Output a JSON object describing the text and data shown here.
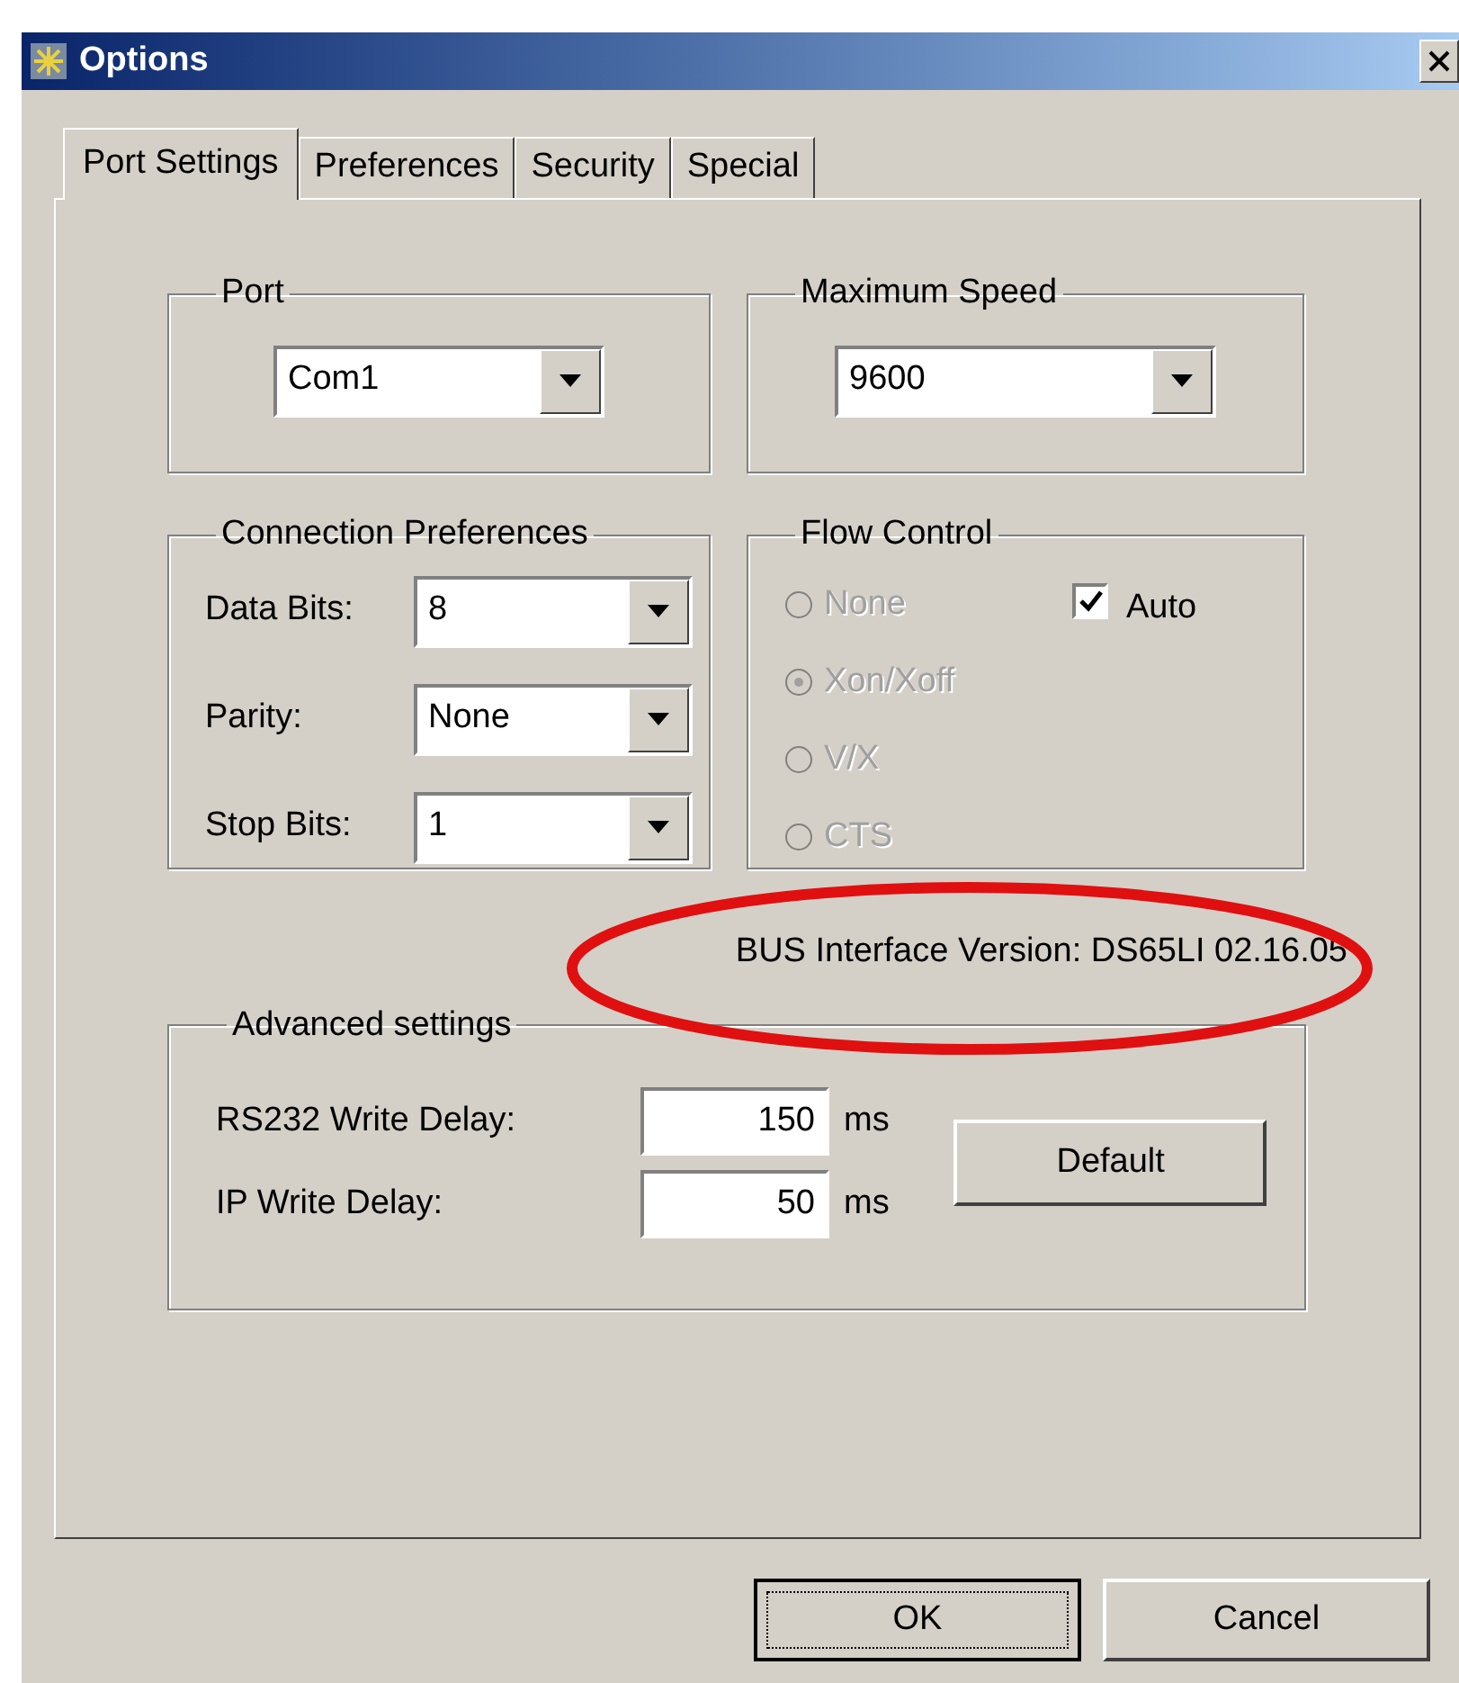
{
  "window": {
    "title": "Options"
  },
  "tabs": [
    {
      "label": "Port Settings",
      "selected": true
    },
    {
      "label": "Preferences",
      "selected": false
    },
    {
      "label": "Security",
      "selected": false
    },
    {
      "label": "Special",
      "selected": false
    }
  ],
  "port": {
    "title": "Port",
    "value": "Com1"
  },
  "max_speed": {
    "title": "Maximum Speed",
    "value": "9600"
  },
  "connection_preferences": {
    "title": "Connection Preferences",
    "fields": [
      {
        "label": "Data Bits:",
        "value": "8"
      },
      {
        "label": "Parity:",
        "value": "None"
      },
      {
        "label": "Stop Bits:",
        "value": "1"
      }
    ]
  },
  "flow_control": {
    "title": "Flow Control",
    "options": [
      {
        "label": "None",
        "selected": false,
        "disabled": true
      },
      {
        "label": "Xon/Xoff",
        "selected": true,
        "disabled": true
      },
      {
        "label": "V/X",
        "selected": false,
        "disabled": true
      },
      {
        "label": "CTS",
        "selected": false,
        "disabled": true
      }
    ],
    "auto": {
      "label": "Auto",
      "checked": true
    }
  },
  "version": "BUS Interface Version: DS65LI 02.16.05",
  "advanced": {
    "title": "Advanced settings",
    "fields": [
      {
        "label": "RS232 Write Delay:",
        "value": "150",
        "unit": "ms"
      },
      {
        "label": "IP Write Delay:",
        "value": "50",
        "unit": "ms"
      }
    ],
    "default_button": "Default"
  },
  "buttons": [
    {
      "label": "OK",
      "default": true
    },
    {
      "label": "Cancel",
      "default": false
    }
  ]
}
